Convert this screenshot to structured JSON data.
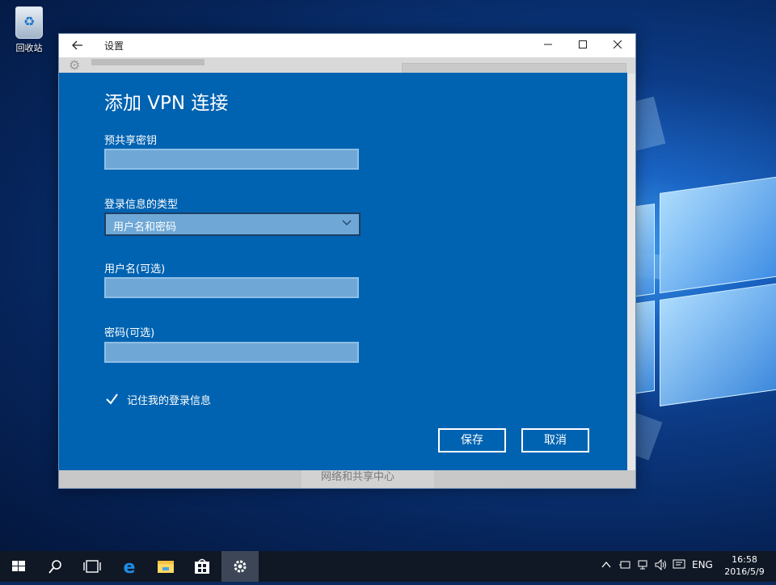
{
  "desktop": {
    "recycle_bin_label": "回收站"
  },
  "window": {
    "title": "设置",
    "background_link": "网络和共享中心"
  },
  "dialog": {
    "title": "添加 VPN 连接",
    "psk_label": "预共享密钥",
    "psk_value": "",
    "signin_type_label": "登录信息的类型",
    "signin_type_selected": "用户名和密码",
    "username_label": "用户名(可选)",
    "username_value": "",
    "password_label": "密码(可选)",
    "password_value": "",
    "remember_label": "记住我的登录信息",
    "remember_checked": true,
    "save_label": "保存",
    "cancel_label": "取消"
  },
  "taskbar": {
    "language": "ENG",
    "time": "16:58",
    "date": "2016/5/9",
    "icons": [
      "start-icon",
      "search-icon",
      "task-view-icon",
      "edge-icon",
      "file-explorer-icon",
      "store-icon",
      "settings-icon"
    ]
  },
  "colors": {
    "dialog_bg": "#0063b1",
    "taskbar_bg": "#101825"
  }
}
